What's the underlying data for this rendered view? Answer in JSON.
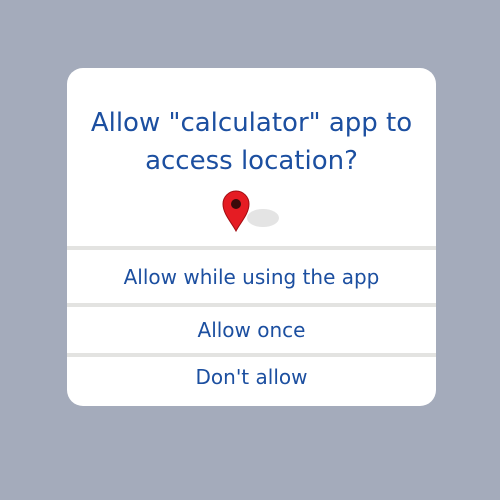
{
  "dialog": {
    "title": "Allow \"calculator\" app to access location?",
    "icon": "location-pin-icon",
    "options": [
      {
        "label": "Allow while using the app"
      },
      {
        "label": "Allow once"
      },
      {
        "label": "Don't allow"
      }
    ]
  },
  "colors": {
    "background": "#a4abbb",
    "dialog": "#ffffff",
    "text": "#1c4fa0",
    "pin": "#e51c23",
    "divider": "#e3e3e1"
  }
}
